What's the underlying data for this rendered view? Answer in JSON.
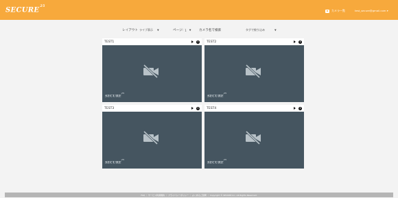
{
  "header": {
    "logo": "SECURE",
    "logo_sup": "25",
    "camera_list_label": "カメラ一覧",
    "user_email": "test_secure@gmail.com",
    "accent_color": "#f7a93c"
  },
  "controls": {
    "layout_label": "レイアウト",
    "layout_value": "ライブ表示",
    "page_label": "ページ:",
    "page_value": "1",
    "filter_label": "カメラ名で検索",
    "filter_value": "",
    "tag_label": "タグで絞り込み"
  },
  "tiles": [
    {
      "name": "TEST1"
    },
    {
      "name": "TEST2"
    },
    {
      "name": "TEST3"
    },
    {
      "name": "TEST4"
    }
  ],
  "watermark": {
    "text": "SECURE",
    "sup": "25"
  },
  "footer": {
    "text": "FAQ ｜ サービス利用規約 ｜ プライバシーポリシー ｜ よくあるご質問 ｜ Copyright © SECURE Inc. All Rights Reserved."
  }
}
